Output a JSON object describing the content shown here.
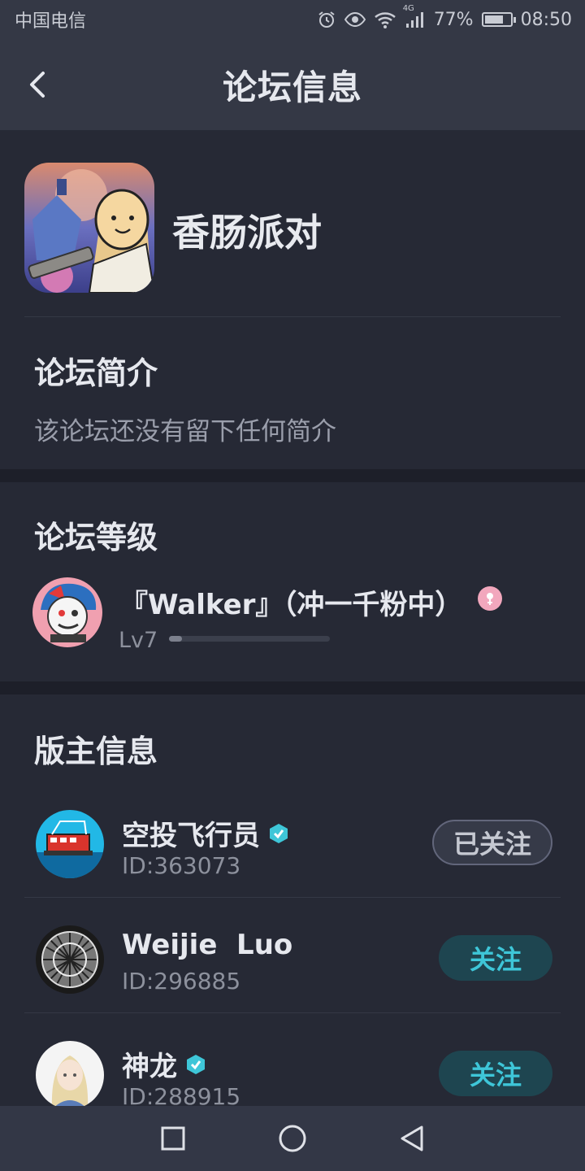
{
  "status_bar": {
    "carrier": "中国电信",
    "network": "4G",
    "battery": "77%",
    "battery_level": 0.77,
    "time": "08:50"
  },
  "header": {
    "title": "论坛信息",
    "back_icon": "chevron-left-icon"
  },
  "forum": {
    "name": "香肠派对"
  },
  "intro": {
    "title": "论坛简介",
    "text": "该论坛还没有留下任何简介"
  },
  "level": {
    "title": "论坛等级",
    "user_name": "『Walker』（冲一千粉中）",
    "level_label": "Lv7",
    "progress": 0.08
  },
  "moderators": {
    "title": "版主信息",
    "items": [
      {
        "name": "空投飞行员",
        "id": "ID:363073",
        "verified": true,
        "button": "已关注",
        "followed": true
      },
      {
        "name": "Weijie  Luo",
        "id": "ID:296885",
        "verified": false,
        "button": "关注",
        "followed": false
      },
      {
        "name": "神龙",
        "id": "ID:288915",
        "verified": true,
        "button": "关注",
        "followed": false
      }
    ]
  },
  "colors": {
    "background": "#262935",
    "header": "#343845",
    "accent": "#3ec6d8",
    "verify": "#3ec6d8"
  }
}
